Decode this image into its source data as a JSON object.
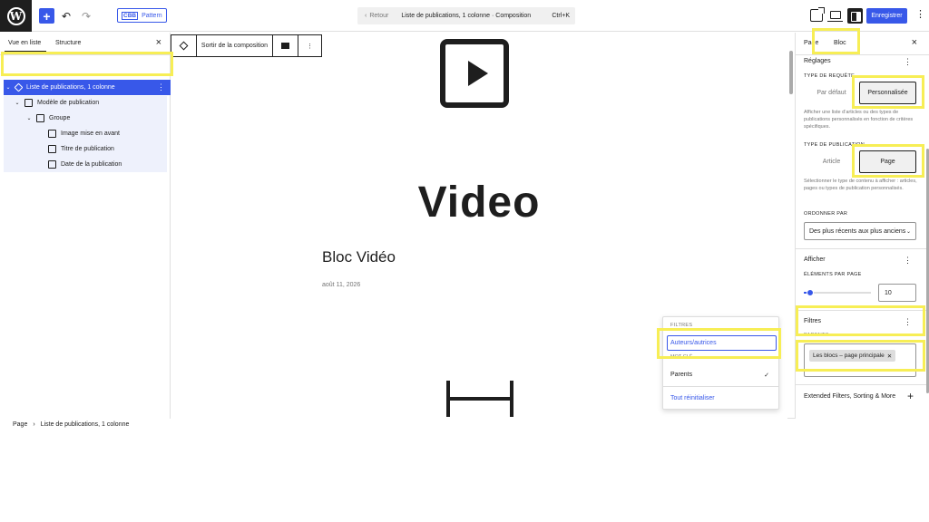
{
  "topbar": {
    "logo_letter": "W",
    "add_icon": "plus-icon",
    "undo_icon": "undo-icon",
    "redo_icon": "redo-icon",
    "pattern_badge": "CBB",
    "pattern_label": "Pattern",
    "back_label": "Retour",
    "doc_title": "Liste de publications, 1 colonne · Composition",
    "shortcut": "Ctrl+K",
    "save_label": "Enregistrer"
  },
  "list_view": {
    "tab_list": "Vue en liste",
    "tab_outline": "Structure",
    "items": [
      {
        "label": "Liste de publications, 1 colonne",
        "icon": "query-loop-icon"
      },
      {
        "label": "Modèle de publication",
        "icon": "post-template-icon"
      },
      {
        "label": "Groupe",
        "icon": "group-icon"
      },
      {
        "label": "Image mise en avant",
        "icon": "featured-image-icon"
      },
      {
        "label": "Titre de publication",
        "icon": "post-title-icon"
      },
      {
        "label": "Date de la publication",
        "icon": "post-date-icon"
      }
    ]
  },
  "block_toolbar": {
    "exit_label": "Sortir de la composition"
  },
  "canvas": {
    "video_heading": "Video",
    "post_title": "Bloc Vidéo",
    "post_date": "août 11, 2026"
  },
  "filters_popover": {
    "heading": "FILTRES",
    "item_authors": "Auteurs/autrices",
    "item_partial": "MOT-CLÉ",
    "item_parents": "Parents",
    "reset": "Tout réinitialiser"
  },
  "sidebar": {
    "tab_page": "Page",
    "tab_block": "Bloc",
    "settings_title": "Réglages",
    "query_type_label": "TYPE DE REQUÊTE",
    "query_default": "Par défaut",
    "query_custom": "Personnalisée",
    "query_help": "Afficher une liste d’articles ou des types de publications personnalisés en fonction de critères spécifiques.",
    "post_type_label": "TYPE DE PUBLICATION",
    "post_type_article": "Article",
    "post_type_page": "Page",
    "post_type_help": "Sélectionner le type de contenu à afficher : articles, pages ou types de publication personnalisés.",
    "order_label": "ORDONNER PAR",
    "order_value": "Des plus récents aux plus anciens",
    "display_title": "Afficher",
    "per_page_label": "ÉLÉMENTS PAR PAGE",
    "per_page_value": "10",
    "per_page_level": 0.1,
    "filters_title": "Filtres",
    "parents_label": "PARENTS",
    "parent_token": "Les blocs – page principale",
    "extended_label": "Extended Filters, Sorting & More"
  },
  "breadcrumb": {
    "root": "Page",
    "current": "Liste de publications, 1 colonne"
  },
  "colors": {
    "accent": "#3858e9",
    "highlight": "#f7ee55",
    "dark": "#1e1e1e"
  }
}
